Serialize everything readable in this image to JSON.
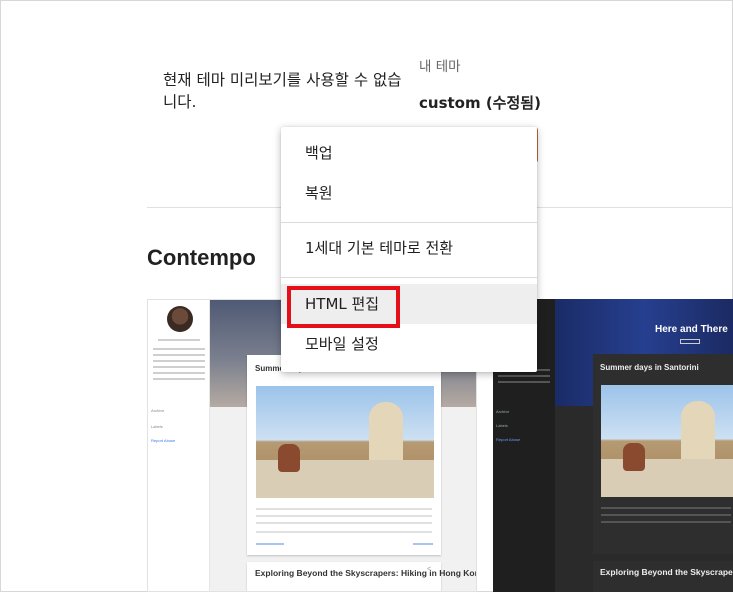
{
  "preview_notice": "현재 테마 미리보기를 사용할 수 없습니다.",
  "my_theme": {
    "label": "내 테마",
    "name": "custom (수정됨)"
  },
  "section_title": "Contempo",
  "menu": {
    "items": [
      "백업",
      "복원",
      "1세대 기본 테마로 전환",
      "HTML 편집",
      "모바일 설정"
    ],
    "highlighted_item": "HTML 편집"
  },
  "thumbnails": {
    "light": {
      "post1_title": "Summer days in Santorini",
      "post2_title": "Exploring Beyond the Skyscrapers: Hiking in Hong Kong",
      "sidebar_items": [
        "Archive",
        "Labels",
        "Report Abuse"
      ]
    },
    "dark": {
      "header_title": "Here and There",
      "post1_title": "Summer days in Santorini",
      "post2_title": "Exploring Beyond the Skyscrapers: Hiking in Hong Kong",
      "sidebar_items": [
        "Archive",
        "Labels",
        "Report Abuse"
      ]
    }
  },
  "colors": {
    "highlight": "#e3101a",
    "accent_button": "#c5673c"
  }
}
